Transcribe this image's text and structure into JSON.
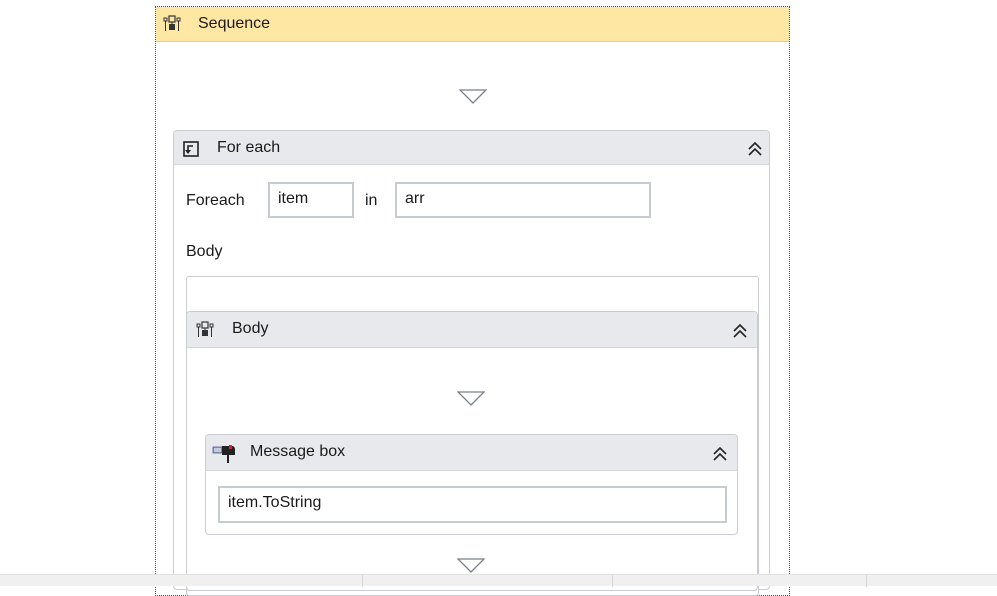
{
  "sequence": {
    "title": "Sequence",
    "header_color": "#fde7a3",
    "icon": "sequence-icon"
  },
  "foreach": {
    "title": "For each",
    "icon": "foreach-icon",
    "foreach_label": "Foreach",
    "item_value": "item",
    "in_label": "in",
    "collection_value": "arr",
    "body_label": "Body"
  },
  "body_sequence": {
    "title": "Body",
    "icon": "sequence-icon"
  },
  "message_box": {
    "title": "Message box",
    "icon": "message-box-icon",
    "text_value": "item.ToString"
  },
  "icons": {
    "collapse": "chevron-double-up-icon",
    "drop_target": "triangle-down-icon"
  },
  "colors": {
    "panel_header": "#e7e9ec",
    "panel_border": "#c9cdd3",
    "field_border": "#c6cbd1"
  }
}
